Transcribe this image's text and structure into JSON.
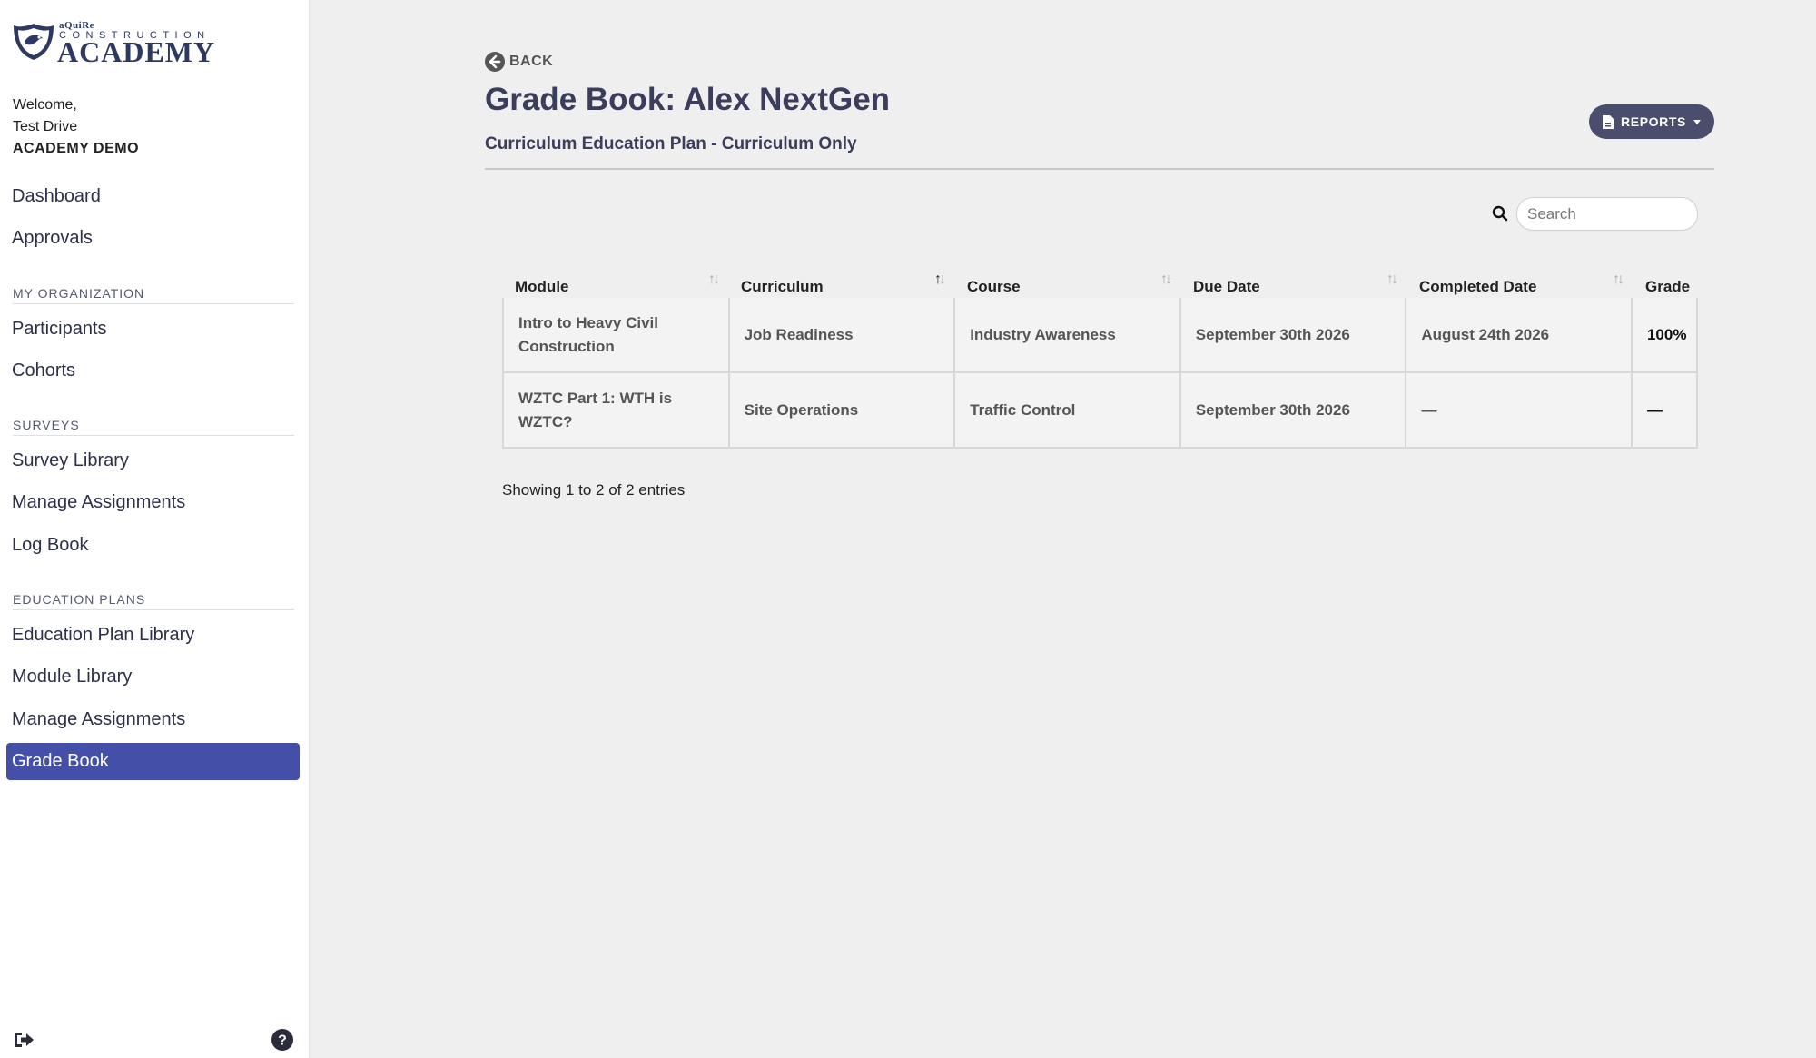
{
  "logo": {
    "line1": "aQuiRe",
    "line2": "CONSTRUCTION",
    "line3": "ACADEMY"
  },
  "user": {
    "welcome": "Welcome,",
    "name": "Test Drive",
    "org": "ACADEMY DEMO"
  },
  "nav": {
    "dashboard": "Dashboard",
    "approvals": "Approvals",
    "section_org": "MY ORGANIZATION",
    "participants": "Participants",
    "cohorts": "Cohorts",
    "section_surveys": "SURVEYS",
    "survey_library": "Survey Library",
    "manage_assignments_surveys": "Manage Assignments",
    "log_book": "Log Book",
    "section_education": "EDUCATION PLANS",
    "education_plan_library": "Education Plan Library",
    "module_library": "Module Library",
    "manage_assignments_edu": "Manage Assignments",
    "grade_book": "Grade Book"
  },
  "main": {
    "back_label": "BACK",
    "title": "Grade Book: Alex NextGen",
    "subtitle": "Curriculum Education Plan - Curriculum Only",
    "reports_label": "REPORTS",
    "search_placeholder": "Search",
    "showing": "Showing 1 to 2 of 2 entries"
  },
  "table": {
    "headers": [
      "Module",
      "Curriculum",
      "Course",
      "Due Date",
      "Completed Date",
      "Grade"
    ],
    "rows": [
      [
        "Intro to Heavy Civil Construction",
        "Job Readiness",
        "Industry Awareness",
        "September 30th 2026",
        "August 24th 2026",
        "100%"
      ],
      [
        "WZTC Part 1: WTH is WZTC?",
        "Site Operations",
        "Traffic Control",
        "September 30th 2026",
        "—",
        "—"
      ]
    ]
  },
  "colors": {
    "accent": "#4450a8",
    "button": "#4a4d6b",
    "title": "#3a3d5c"
  }
}
